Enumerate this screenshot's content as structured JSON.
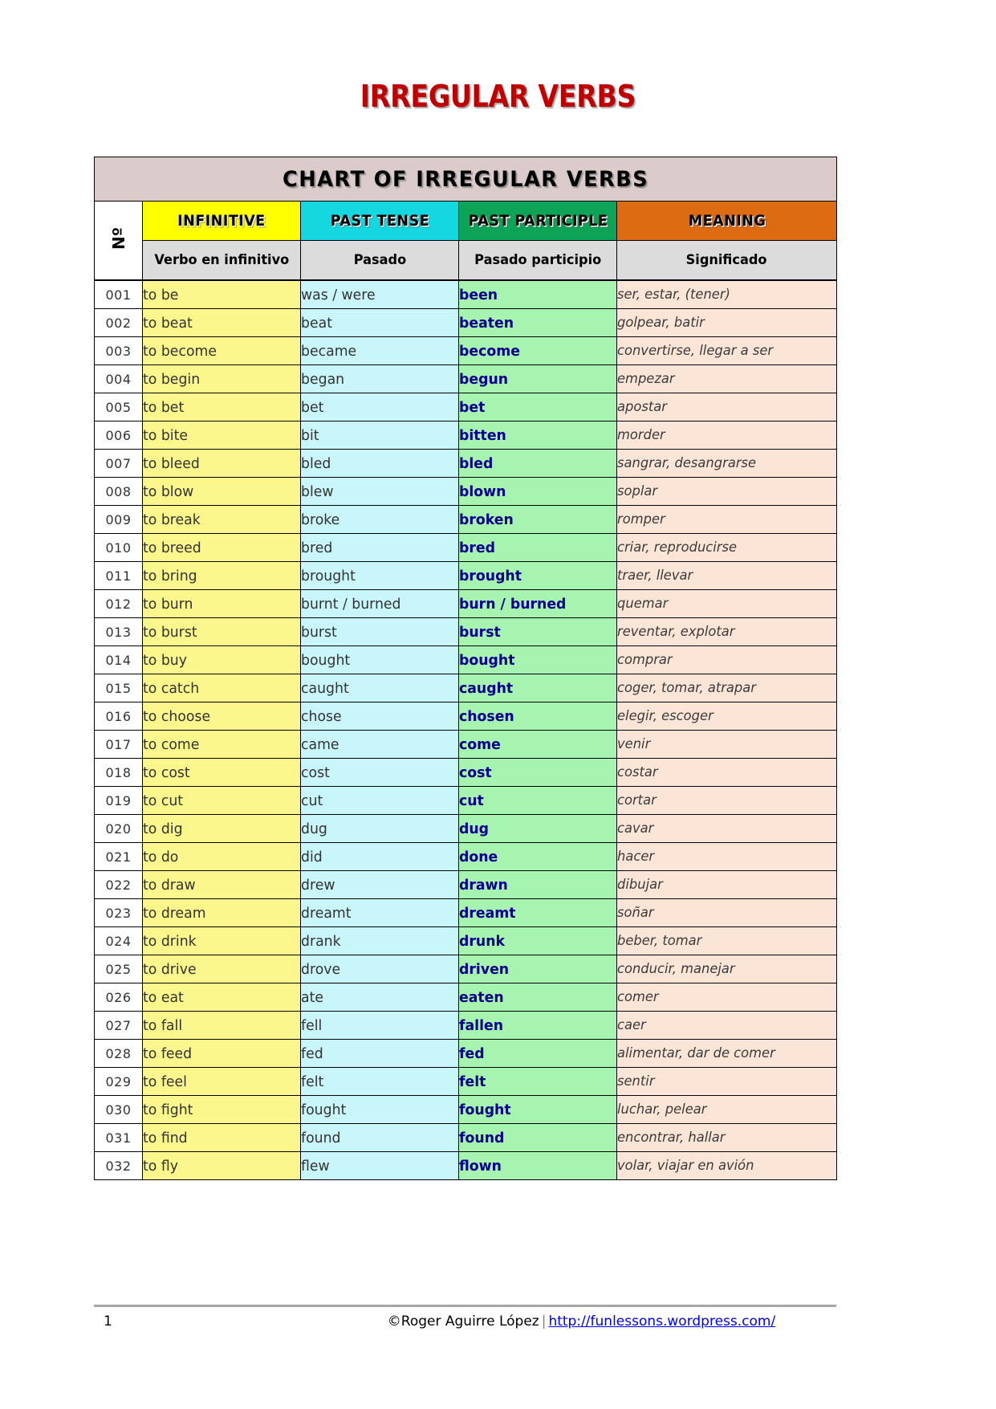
{
  "document": {
    "title": "IRREGULAR VERBS",
    "banner": "CHART OF IRREGULAR VERBS"
  },
  "colors": {
    "title_red": "#C00000",
    "banner_bg": "#DBCBCB",
    "infinitive_header": "#FFFF00",
    "past_tense_header": "#14D7E0",
    "past_participle_header": "#0DA457",
    "meaning_header": "#DD6B11",
    "subheader_bg": "#DCDCDC",
    "infinitive_cell": "#FBF78C",
    "past_tense_cell": "#C8F6FB",
    "past_participle_cell": "#A6F4B0",
    "meaning_cell": "#FAE5D6",
    "participle_text": "#00008B",
    "link": "#0000EE"
  },
  "table": {
    "num_header": "Nº",
    "headers": {
      "infinitive": "INFINITIVE",
      "past_tense": "PAST TENSE",
      "past_participle": "PAST PARTICIPLE",
      "meaning": "MEANING"
    },
    "subheaders": {
      "infinitive": "Verbo en infinitivo",
      "past_tense": "Pasado",
      "past_participle": "Pasado participio",
      "meaning": "Significado"
    },
    "rows": [
      {
        "num": "001",
        "infinitive": "to be",
        "past": "was / were",
        "participle": "been",
        "meaning": "ser, estar, (tener)"
      },
      {
        "num": "002",
        "infinitive": "to beat",
        "past": "beat",
        "participle": "beaten",
        "meaning": "golpear, batir"
      },
      {
        "num": "003",
        "infinitive": "to become",
        "past": "became",
        "participle": "become",
        "meaning": "convertirse, llegar a ser"
      },
      {
        "num": "004",
        "infinitive": "to begin",
        "past": "began",
        "participle": "begun",
        "meaning": "empezar"
      },
      {
        "num": "005",
        "infinitive": "to bet",
        "past": "bet",
        "participle": "bet",
        "meaning": "apostar"
      },
      {
        "num": "006",
        "infinitive": "to bite",
        "past": "bit",
        "participle": "bitten",
        "meaning": "morder"
      },
      {
        "num": "007",
        "infinitive": "to bleed",
        "past": "bled",
        "participle": "bled",
        "meaning": "sangrar, desangrarse"
      },
      {
        "num": "008",
        "infinitive": "to blow",
        "past": "blew",
        "participle": "blown",
        "meaning": "soplar"
      },
      {
        "num": "009",
        "infinitive": "to break",
        "past": "broke",
        "participle": "broken",
        "meaning": "romper"
      },
      {
        "num": "010",
        "infinitive": "to breed",
        "past": "bred",
        "participle": "bred",
        "meaning": "criar, reproducirse"
      },
      {
        "num": "011",
        "infinitive": "to bring",
        "past": "brought",
        "participle": "brought",
        "meaning": "traer, llevar"
      },
      {
        "num": "012",
        "infinitive": "to burn",
        "past": "burnt / burned",
        "participle": "burn / burned",
        "meaning": "quemar"
      },
      {
        "num": "013",
        "infinitive": "to burst",
        "past": "burst",
        "participle": "burst",
        "meaning": "reventar, explotar"
      },
      {
        "num": "014",
        "infinitive": "to buy",
        "past": "bought",
        "participle": "bought",
        "meaning": "comprar"
      },
      {
        "num": "015",
        "infinitive": "to catch",
        "past": "caught",
        "participle": "caught",
        "meaning": "coger, tomar, atrapar"
      },
      {
        "num": "016",
        "infinitive": "to choose",
        "past": "chose",
        "participle": "chosen",
        "meaning": "elegir, escoger"
      },
      {
        "num": "017",
        "infinitive": "to come",
        "past": "came",
        "participle": "come",
        "meaning": "venir"
      },
      {
        "num": "018",
        "infinitive": "to cost",
        "past": "cost",
        "participle": "cost",
        "meaning": "costar"
      },
      {
        "num": "019",
        "infinitive": "to cut",
        "past": "cut",
        "participle": "cut",
        "meaning": "cortar"
      },
      {
        "num": "020",
        "infinitive": "to dig",
        "past": "dug",
        "participle": "dug",
        "meaning": "cavar"
      },
      {
        "num": "021",
        "infinitive": "to do",
        "past": "did",
        "participle": "done",
        "meaning": "hacer"
      },
      {
        "num": "022",
        "infinitive": "to draw",
        "past": "drew",
        "participle": "drawn",
        "meaning": "dibujar"
      },
      {
        "num": "023",
        "infinitive": "to dream",
        "past": "dreamt",
        "participle": "dreamt",
        "meaning": "soñar"
      },
      {
        "num": "024",
        "infinitive": "to drink",
        "past": "drank",
        "participle": "drunk",
        "meaning": "beber, tomar"
      },
      {
        "num": "025",
        "infinitive": "to drive",
        "past": "drove",
        "participle": "driven",
        "meaning": "conducir, manejar"
      },
      {
        "num": "026",
        "infinitive": "to eat",
        "past": "ate",
        "participle": "eaten",
        "meaning": "comer"
      },
      {
        "num": "027",
        "infinitive": "to fall",
        "past": "fell",
        "participle": "fallen",
        "meaning": "caer"
      },
      {
        "num": "028",
        "infinitive": "to feed",
        "past": "fed",
        "participle": "fed",
        "meaning": "alimentar, dar de comer"
      },
      {
        "num": "029",
        "infinitive": "to feel",
        "past": "felt",
        "participle": "felt",
        "meaning": "sentir"
      },
      {
        "num": "030",
        "infinitive": "to fight",
        "past": "fought",
        "participle": "fought",
        "meaning": "luchar, pelear"
      },
      {
        "num": "031",
        "infinitive": "to find",
        "past": "found",
        "participle": "found",
        "meaning": "encontrar, hallar"
      },
      {
        "num": "032",
        "infinitive": "to fly",
        "past": "flew",
        "participle": "flown",
        "meaning": "volar, viajar en avión"
      }
    ]
  },
  "footer": {
    "page_number": "1",
    "copyright": "©Roger Aguirre López",
    "separator": "|",
    "url": "http://funlessons.wordpress.com/"
  }
}
